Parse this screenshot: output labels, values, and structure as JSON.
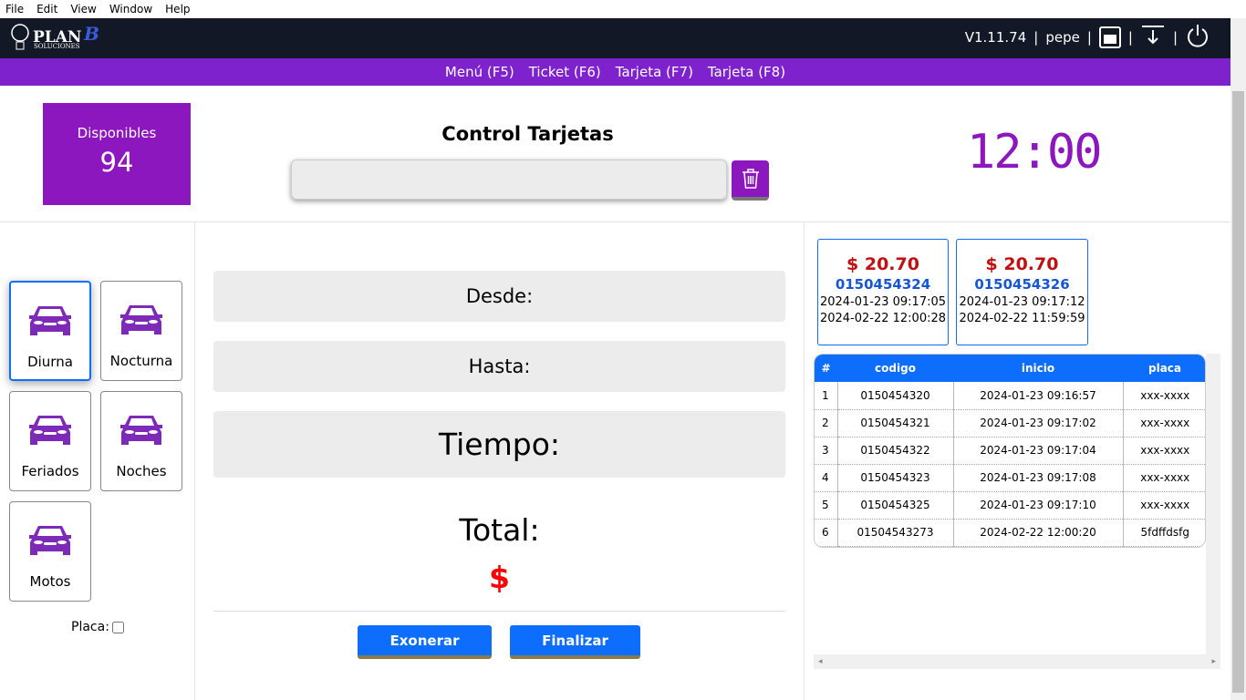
{
  "menu": [
    "File",
    "Edit",
    "View",
    "Window",
    "Help"
  ],
  "header": {
    "logo": "PLAN B SOLUCIONES",
    "version": "V1.11.74",
    "user": "pepe",
    "sep": "|"
  },
  "nav": [
    "Menú (F5)",
    "Ticket (F6)",
    "Tarjeta (F7)",
    "Tarjeta (F8)"
  ],
  "disponibles": {
    "label": "Disponibles",
    "value": "94"
  },
  "title": "Control Tarjetas",
  "input": {
    "value": "",
    "placeholder": ""
  },
  "clock": "12:00",
  "categories": [
    {
      "label": "Diurna"
    },
    {
      "label": "Nocturna"
    },
    {
      "label": "Feriados"
    },
    {
      "label": "Noches"
    },
    {
      "label": "Motos"
    }
  ],
  "placa_label": "Placa:",
  "fields": {
    "desde": "Desde:",
    "hasta": "Hasta:",
    "tiempo": "Tiempo:",
    "total": "Total:",
    "currency": "$"
  },
  "buttons": {
    "exonerar": "Exonerar",
    "finalizar": "Finalizar"
  },
  "cards": [
    {
      "price": "$ 20.70",
      "code": "0150454324",
      "start": "2024-01-23 09:17:05",
      "end": "2024-02-22 12:00:28"
    },
    {
      "price": "$ 20.70",
      "code": "0150454326",
      "start": "2024-01-23 09:17:12",
      "end": "2024-02-22 11:59:59"
    }
  ],
  "table": {
    "headers": [
      "#",
      "codigo",
      "inicio",
      "placa"
    ],
    "rows": [
      [
        "1",
        "0150454320",
        "2024-01-23 09:16:57",
        "xxx-xxxx"
      ],
      [
        "2",
        "0150454321",
        "2024-01-23 09:17:02",
        "xxx-xxxx"
      ],
      [
        "3",
        "0150454322",
        "2024-01-23 09:17:04",
        "xxx-xxxx"
      ],
      [
        "4",
        "0150454323",
        "2024-01-23 09:17:08",
        "xxx-xxxx"
      ],
      [
        "5",
        "0150454325",
        "2024-01-23 09:17:10",
        "xxx-xxxx"
      ],
      [
        "6",
        "01504543273",
        "2024-02-22 12:00:20",
        "5fdffdsfg"
      ]
    ]
  }
}
